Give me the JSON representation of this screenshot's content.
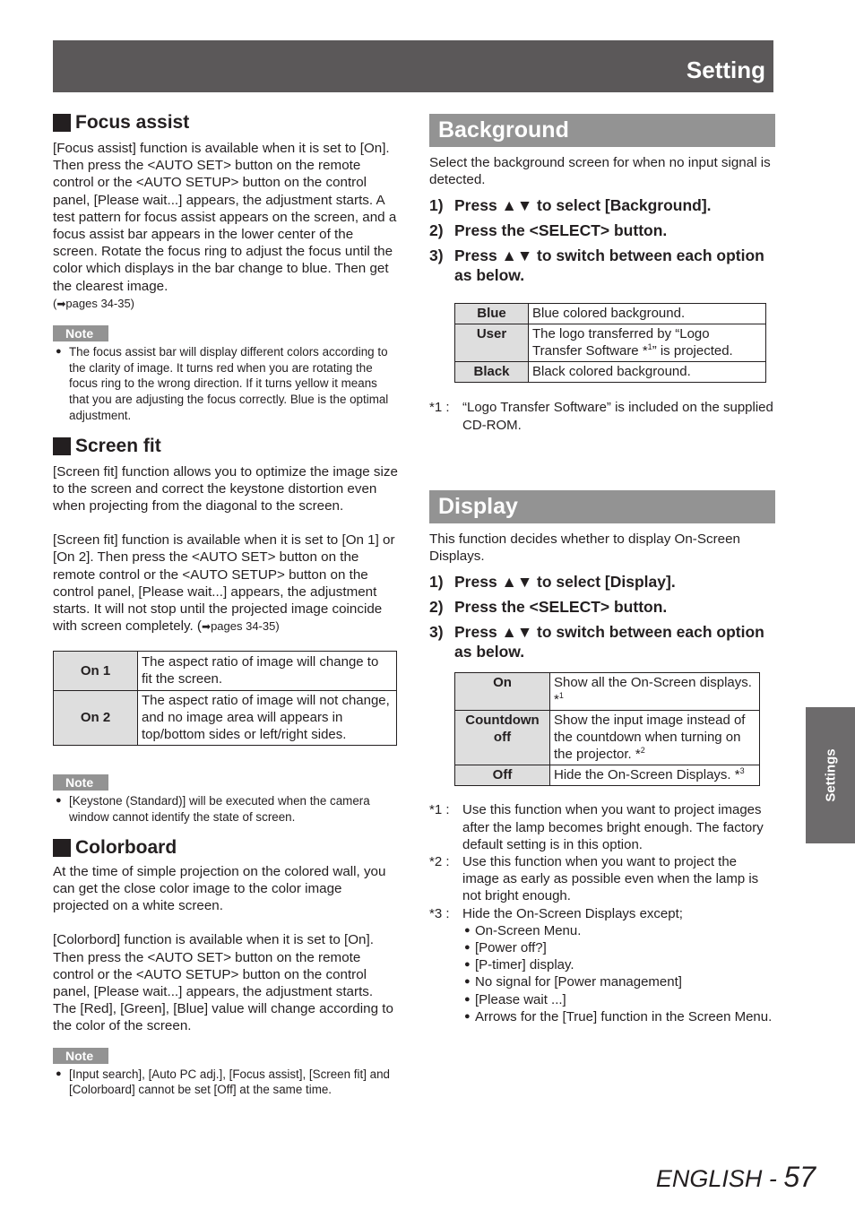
{
  "header": {
    "title": "Setting"
  },
  "side_tab": {
    "label": "Settings"
  },
  "footer": {
    "language": "ENGLISH",
    "separator": " - ",
    "page_number": "57"
  },
  "focus_assist": {
    "heading": "Focus assist",
    "body": "[Focus assist] function is available when it is set to [On]. Then press the <AUTO SET> button on the remote control or the <AUTO SETUP> button on the control panel, [Please wait...] appears, the adjustment starts. A test pattern for focus assist appears on the screen, and a focus assist bar appears in the lower center of the screen. Rotate the focus ring to adjust the focus until the color which displays in the bar change to blue. Then get the clearest image.",
    "ref_open": "(",
    "ref_arrow": "➡",
    "ref_text": "pages 34-35)",
    "note_label": "Note",
    "note": "The focus assist bar will display different colors according to the clarity of image. It turns red when you are rotating the focus ring to the wrong direction. If it turns yellow it means that you are adjusting the focus correctly. Blue is the optimal adjustment."
  },
  "screen_fit": {
    "heading": "Screen fit",
    "body1": "[Screen fit] function allows you to optimize the image size to the screen and correct the keystone distortion even when projecting from the diagonal to the screen.",
    "body2": "[Screen fit] function is available when it is set to [On 1] or [On 2]. Then press the <AUTO SET> button on the remote control or the <AUTO SETUP> button on the control panel, [Please wait...] appears, the adjustment starts. It will not stop until the projected image coincide with screen completely. (",
    "ref_arrow": "➡",
    "ref_text": "pages 34-35)",
    "table": [
      {
        "key": "On 1",
        "desc": "The aspect ratio of image will change to fit the screen."
      },
      {
        "key": "On 2",
        "desc": "The aspect ratio of image will not change, and no image area will appears in top/bottom sides or left/right sides."
      }
    ],
    "note_label": "Note",
    "note": "[Keystone (Standard)] will be executed when the camera window cannot identify the state of screen."
  },
  "colorboard": {
    "heading": "Colorboard",
    "body1": "At the time of simple projection on the colored wall, you can get the close color image to the color image projected on a white screen.",
    "body2": "[Colorbord] function is available when it is set to [On]. Then press the <AUTO SET> button on the remote control or the <AUTO SETUP> button on the control panel, [Please wait...] appears, the adjustment starts. The [Red], [Green], [Blue] value will change according to the color of the screen.",
    "note_label": "Note",
    "note": "[Input search], [Auto PC adj.], [Focus assist], [Screen fit] and [Colorboard] cannot be set [Off] at the same time."
  },
  "background": {
    "heading": "Background",
    "intro": "Select the background screen for when no input signal is detected.",
    "steps": [
      {
        "num": "1)",
        "text": "Press ▲▼ to select [Background]."
      },
      {
        "num": "2)",
        "text": "Press the <SELECT> button."
      },
      {
        "num": "3)",
        "text": "Press ▲▼ to switch between each option as below."
      }
    ],
    "table": [
      {
        "key": "Blue",
        "desc": "Blue colored background."
      },
      {
        "key": "User",
        "desc_a": "The logo transferred by “Logo Transfer Software *",
        "sup": "1",
        "desc_b": "” is projected."
      },
      {
        "key": "Black",
        "desc": "Black colored background."
      }
    ],
    "footnotes": [
      {
        "mark": "*1 :",
        "text": "“Logo Transfer Software” is included on the supplied CD-ROM."
      }
    ]
  },
  "display": {
    "heading": "Display",
    "intro": "This function decides whether to display On-Screen Displays.",
    "steps": [
      {
        "num": "1)",
        "text": "Press ▲▼ to select [Display]."
      },
      {
        "num": "2)",
        "text": "Press the <SELECT> button."
      },
      {
        "num": "3)",
        "text": "Press ▲▼ to switch between each option as below."
      }
    ],
    "table": [
      {
        "key": "On",
        "desc": "Show all the On-Screen displays. *",
        "sup": "1"
      },
      {
        "key": "Countdown off",
        "desc": "Show the input image instead of the countdown when turning on the projector. *",
        "sup": "2"
      },
      {
        "key": "Off",
        "desc": "Hide the On-Screen Displays. *",
        "sup": "3"
      }
    ],
    "footnotes": [
      {
        "mark": "*1 :",
        "text": "Use this function when you want to project images after the lamp becomes bright enough. The factory default setting is in this option."
      },
      {
        "mark": "*2 :",
        "text": "Use this function when you want to project the image as early as possible even when the lamp is not bright enough."
      },
      {
        "mark": "*3 :",
        "text": "Hide the On-Screen Displays except;"
      }
    ],
    "exceptions": [
      "On-Screen Menu.",
      "[Power off?]",
      "[P-timer] display.",
      "No signal for [Power management]",
      "[Please wait ...]",
      "Arrows for the [True] function in the Screen Menu."
    ]
  }
}
